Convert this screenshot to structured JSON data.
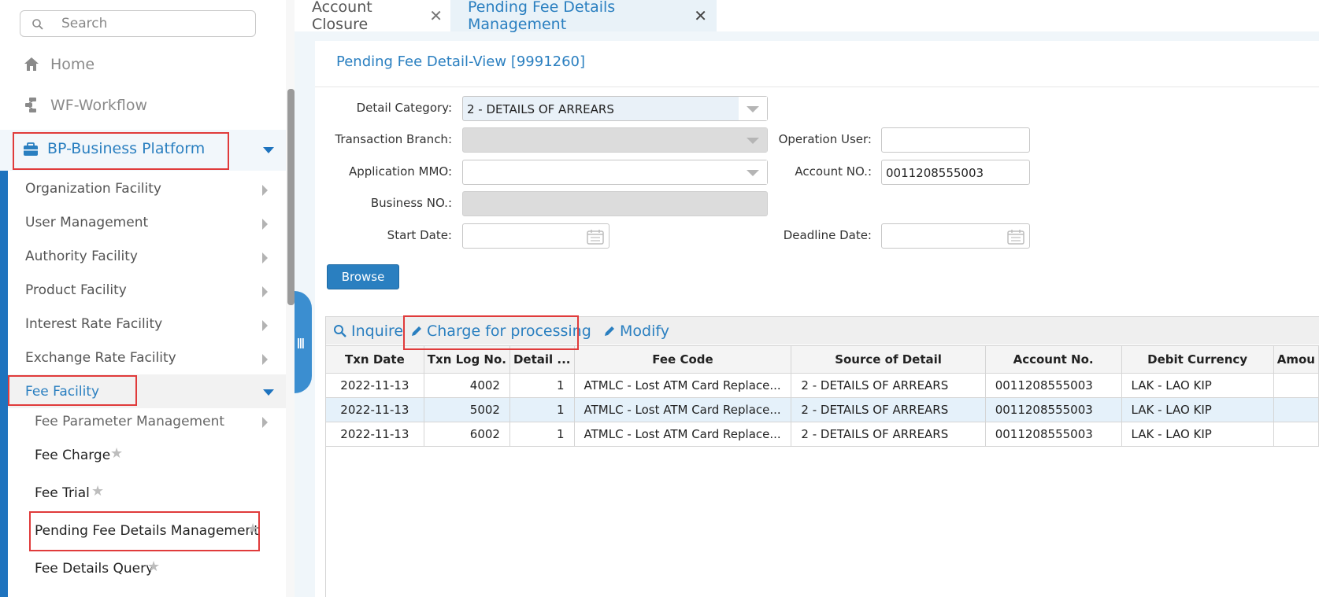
{
  "sidebar": {
    "search_placeholder": "Search",
    "home_label": "Home",
    "workflow_label": "WF-Workflow",
    "business_platform_label": "BP-Business Platform",
    "menu_items": [
      "Organization Facility",
      "User Management",
      "Authority Facility",
      "Product Facility",
      "Interest Rate Facility",
      "Exchange Rate Facility"
    ],
    "fee_facility_label": "Fee Facility",
    "fee_sub_items": [
      "Fee Parameter Management",
      "Fee Charge",
      "Fee Trial",
      "Pending Fee Details Management",
      "Fee Details Query"
    ]
  },
  "tabs": [
    {
      "label": "Account Closure",
      "close": "✕"
    },
    {
      "label": "Pending Fee Details Management",
      "close": "✕"
    }
  ],
  "panel": {
    "title": "Pending Fee Detail-View [9991260]",
    "fields": {
      "detail_category_label": "Detail Category:",
      "detail_category_value": "2 - DETAILS OF ARREARS",
      "transaction_branch_label": "Transaction Branch:",
      "transaction_branch_value": "",
      "application_mmo_label": "Application MMO:",
      "application_mmo_value": "",
      "business_no_label": "Business NO.:",
      "business_no_value": "",
      "start_date_label": "Start Date:",
      "start_date_value": "",
      "operation_user_label": "Operation User:",
      "operation_user_value": "",
      "account_no_label": "Account NO.:",
      "account_no_value": "0011208555003",
      "deadline_date_label": "Deadline Date:",
      "deadline_date_value": ""
    },
    "browse_label": "Browse"
  },
  "toolbar": {
    "inquire_label": "Inquire",
    "charge_label": "Charge for processing",
    "modify_label": "Modify"
  },
  "grid": {
    "columns": [
      "Txn Date",
      "Txn Log No.",
      "Detail ...",
      "Fee Code",
      "Source of Detail",
      "Account No.",
      "Debit Currency",
      "Amou"
    ],
    "rows": [
      [
        "2022-11-13",
        "4002",
        "1",
        "ATMLC - Lost ATM Card Replace...",
        "2 - DETAILS OF ARREARS",
        "0011208555003",
        "LAK - LAO KIP",
        ""
      ],
      [
        "2022-11-13",
        "5002",
        "1",
        "ATMLC - Lost ATM Card Replace...",
        "2 - DETAILS OF ARREARS",
        "0011208555003",
        "LAK - LAO KIP",
        ""
      ],
      [
        "2022-11-13",
        "6002",
        "1",
        "ATMLC - Lost ATM Card Replace...",
        "2 - DETAILS OF ARREARS",
        "0011208555003",
        "LAK - LAO KIP",
        ""
      ]
    ],
    "selected_row": 1
  },
  "colors": {
    "accent": "#2a7fc0",
    "highlight_box": "#e03b3b",
    "sidebar_bar": "#1e73be"
  }
}
